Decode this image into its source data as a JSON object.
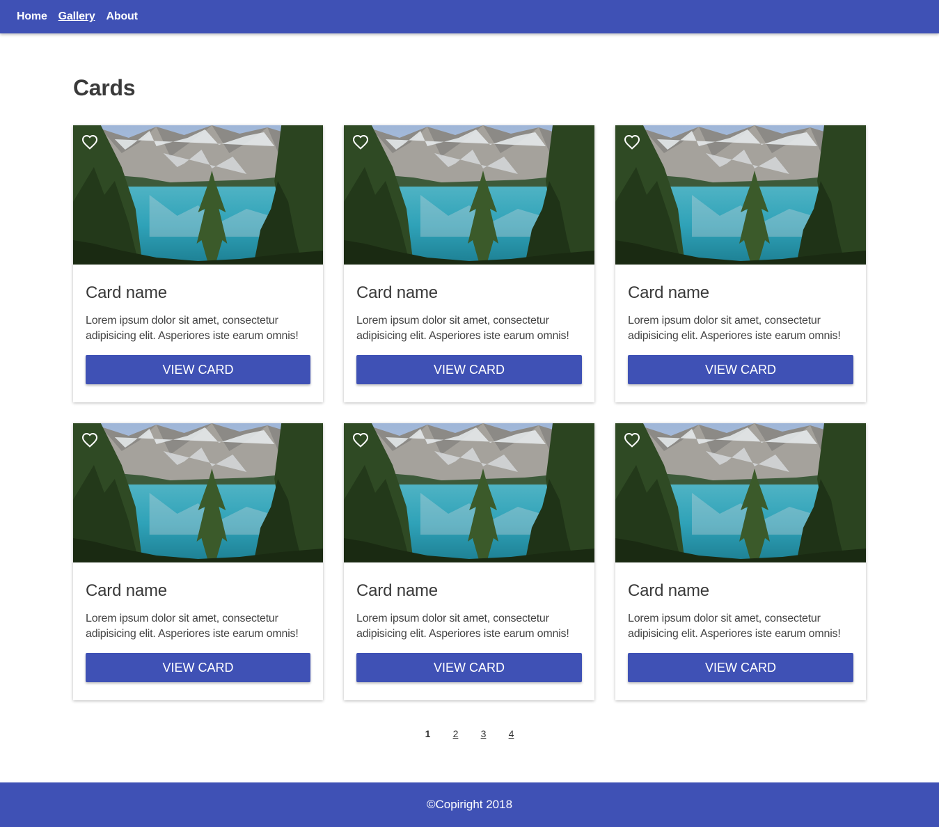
{
  "nav": {
    "items": [
      {
        "label": "Home",
        "active": false
      },
      {
        "label": "Gallery",
        "active": true
      },
      {
        "label": "About",
        "active": false
      }
    ]
  },
  "page": {
    "title": "Cards"
  },
  "cards": [
    {
      "title": "Card name",
      "text": "Lorem ipsum dolor sit amet, consectetur adipisicing elit. Asperiores iste earum omnis!",
      "button": "VIEW CARD",
      "icon": "heart-outline-icon"
    },
    {
      "title": "Card name",
      "text": "Lorem ipsum dolor sit amet, consectetur adipisicing elit. Asperiores iste earum omnis!",
      "button": "VIEW CARD",
      "icon": "heart-outline-icon"
    },
    {
      "title": "Card name",
      "text": "Lorem ipsum dolor sit amet, consectetur adipisicing elit. Asperiores iste earum omnis!",
      "button": "VIEW CARD",
      "icon": "heart-outline-icon"
    },
    {
      "title": "Card name",
      "text": "Lorem ipsum dolor sit amet, consectetur adipisicing elit. Asperiores iste earum omnis!",
      "button": "VIEW CARD",
      "icon": "heart-outline-icon"
    },
    {
      "title": "Card name",
      "text": "Lorem ipsum dolor sit amet, consectetur adipisicing elit. Asperiores iste earum omnis!",
      "button": "VIEW CARD",
      "icon": "heart-outline-icon"
    },
    {
      "title": "Card name",
      "text": "Lorem ipsum dolor sit amet, consectetur adipisicing elit. Asperiores iste earum omnis!",
      "button": "VIEW CARD",
      "icon": "heart-outline-icon"
    }
  ],
  "pagination": {
    "pages": [
      "1",
      "2",
      "3",
      "4"
    ],
    "current": "1"
  },
  "footer": {
    "text": "©Copiright 2018"
  },
  "colors": {
    "primary": "#3f51b5",
    "text": "#333333",
    "background": "#ffffff"
  }
}
